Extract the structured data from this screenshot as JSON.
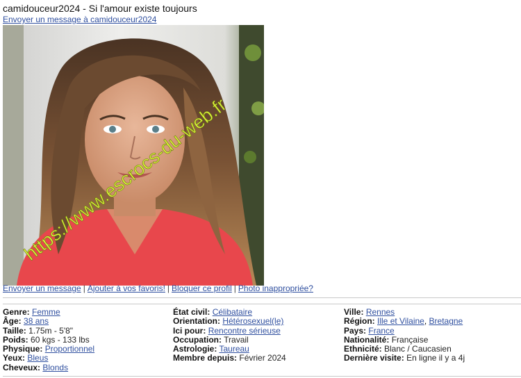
{
  "profile": {
    "username": "camidouceur2024",
    "title": "camidouceur2024 - Si l'amour existe toujours",
    "send_message_link": "Envoyer un message à camidouceur2024",
    "watermark": "https://www.escrocs-du-web.fr"
  },
  "actions": {
    "send_message": "Envoyer un message",
    "add_favorite": "Ajouter à vos favoris!",
    "block": "Bloquer ce profil",
    "report_photo": "Photo inappropriée?"
  },
  "details": {
    "col1": [
      {
        "label": "Genre:",
        "value": "Femme",
        "link": true
      },
      {
        "label": "Âge:",
        "value": "38 ans",
        "link": true
      },
      {
        "label": "Taille:",
        "value": "1.75m - 5'8\"",
        "link": false
      },
      {
        "label": "Poids:",
        "value": "60 kgs - 133 lbs",
        "link": false
      },
      {
        "label": "Physique:",
        "value": "Proportionnel",
        "link": true
      },
      {
        "label": "Yeux:",
        "value": "Bleus",
        "link": true
      },
      {
        "label": "Cheveux:",
        "value": "Blonds",
        "link": true
      }
    ],
    "col2": [
      {
        "label": "État civil:",
        "value": "Célibataire",
        "link": true
      },
      {
        "label": "Orientation:",
        "value": "Hétérosexuel(le)",
        "link": true
      },
      {
        "label": "Ici pour:",
        "value": "Rencontre sérieuse",
        "link": true
      },
      {
        "label": "Occupation:",
        "value": "Travail",
        "link": false
      },
      {
        "label": "Astrologie:",
        "value": "Taureau",
        "link": true
      },
      {
        "label": "Membre depuis:",
        "value": "Février 2024",
        "link": false
      }
    ],
    "col3_ville": {
      "label": "Ville:",
      "value": "Rennes"
    },
    "col3_region": {
      "label": "Région:",
      "value1": "Ille et Vilaine",
      "value2": "Bretagne"
    },
    "col3_pays": {
      "label": "Pays:",
      "value": "France"
    },
    "col3_nationalite": {
      "label": "Nationalité:",
      "value": "Française"
    },
    "col3_ethnicite": {
      "label": "Ethnicité:",
      "value": "Blanc / Caucasien"
    },
    "col3_visite": {
      "label": "Dernière visite:",
      "value": "En ligne il y a 4j"
    }
  },
  "colors": {
    "link": "#2f4f9f",
    "divider": "#c8c8c8",
    "watermark": "#d9f03a",
    "shirt": "#e8474c"
  }
}
